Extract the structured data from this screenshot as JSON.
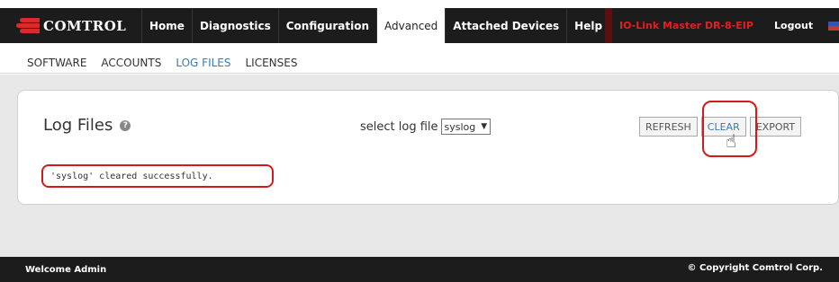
{
  "header": {
    "logo_text": "COMTROL",
    "nav": [
      {
        "label": "Home",
        "active": false
      },
      {
        "label": "Diagnostics",
        "active": false
      },
      {
        "label": "Configuration",
        "active": false
      },
      {
        "label": "Advanced",
        "active": true
      },
      {
        "label": "Attached Devices",
        "active": false
      },
      {
        "label": "Help",
        "active": false
      }
    ],
    "device_name": "IO-Link Master DR-8-EIP",
    "logout_label": "Logout"
  },
  "subnav": [
    {
      "label": "SOFTWARE",
      "active": false
    },
    {
      "label": "ACCOUNTS",
      "active": false
    },
    {
      "label": "LOG FILES",
      "active": true
    },
    {
      "label": "LICENSES",
      "active": false
    }
  ],
  "panel": {
    "title": "Log Files",
    "help_glyph": "?",
    "select_label": "select log file",
    "select_value": "syslog",
    "buttons": {
      "refresh": "REFRESH",
      "clear": "CLEAR",
      "export": "EXPORT"
    },
    "status_message": "'syslog' cleared successfully."
  },
  "footer": {
    "welcome": "Welcome Admin",
    "copyright": "© Copyright Comtrol Corp."
  },
  "colors": {
    "accent_red": "#d11b1b",
    "link_blue": "#3a7ab8",
    "bar_dark": "#1c1c1c"
  }
}
